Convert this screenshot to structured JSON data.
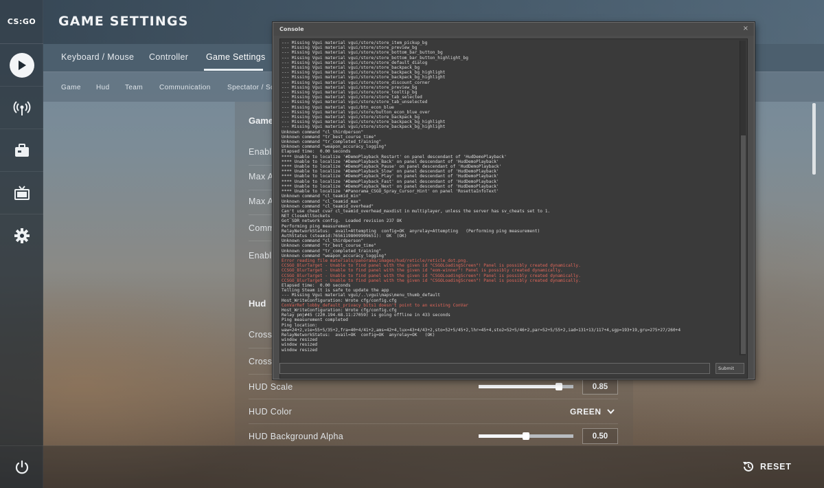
{
  "app": {
    "logo_text": "CS:GO",
    "title": "GAME SETTINGS"
  },
  "sidebar": {
    "items": [
      {
        "icon": "play-icon"
      },
      {
        "icon": "broadcast-icon"
      },
      {
        "icon": "inventory-icon"
      },
      {
        "icon": "tv-icon"
      },
      {
        "icon": "gear-icon"
      },
      {
        "icon": "power-icon"
      }
    ]
  },
  "tabs": [
    {
      "label": "Keyboard / Mouse"
    },
    {
      "label": "Controller"
    },
    {
      "label": "Game Settings",
      "active": true
    }
  ],
  "subtabs": [
    {
      "label": "Game"
    },
    {
      "label": "Hud"
    },
    {
      "label": "Team"
    },
    {
      "label": "Communication"
    },
    {
      "label": "Spectator / Sc"
    }
  ],
  "settings": {
    "game_section_head": "Game",
    "rows_partial": [
      "Enable",
      "Max A",
      "Max A",
      "Comm",
      "Enable"
    ],
    "hud_section_head": "Hud",
    "crosshair_rows": [
      "Crossh",
      "Crossh"
    ],
    "hud_scale_label": "HUD Scale",
    "hud_scale_value": "0.85",
    "hud_scale": 0.85,
    "hud_color_label": "HUD Color",
    "hud_color_value": "GREEN",
    "hud_bg_alpha_label": "HUD Background Alpha",
    "hud_bg_alpha_value": "0.50",
    "hud_bg_alpha": 0.5
  },
  "bottom": {
    "reset_label": "RESET"
  },
  "console": {
    "title": "Console",
    "close_glyph": "×",
    "submit_label": "Submit",
    "input_value": "",
    "lines": [
      {
        "t": "--- Missing Vgui material vgui/store/store_item_pickup_bg"
      },
      {
        "t": "--- Missing Vgui material vgui/store/store_preview_bg"
      },
      {
        "t": "--- Missing Vgui material vgui/store/store_bottom_bar_button_bg"
      },
      {
        "t": "--- Missing Vgui material vgui/store/store_bottom_bar_button_highlight_bg"
      },
      {
        "t": "--- Missing Vgui material vgui/store/store_default_dialog"
      },
      {
        "t": "--- Missing Vgui material vgui/store/store_backpack_bg"
      },
      {
        "t": "--- Missing Vgui material vgui/store/store_backpack_bg_highlight"
      },
      {
        "t": "--- Missing Vgui material vgui/store/store_backpack_bg_highlight"
      },
      {
        "t": "--- Missing Vgui material vgui/store/store_discount_corner"
      },
      {
        "t": "--- Missing Vgui material vgui/store/store_preview_bg"
      },
      {
        "t": "--- Missing Vgui material vgui/store/store_tooltip_bg"
      },
      {
        "t": "--- Missing Vgui material vgui/store/store_tab_selected"
      },
      {
        "t": "--- Missing Vgui material vgui/store/store_tab_unselected"
      },
      {
        "t": "--- Missing Vgui material vgui/btn_econ_blue"
      },
      {
        "t": "--- Missing Vgui material vgui/store/button_econ_blue_over"
      },
      {
        "t": "--- Missing Vgui material vgui/store/store_backpack_bg"
      },
      {
        "t": "--- Missing Vgui material vgui/store/store_backpack_bg_highlight"
      },
      {
        "t": "--- Missing Vgui material vgui/store/store_backpack_bg_highlight"
      },
      {
        "t": "Unknown command \"cl_thirdperson\""
      },
      {
        "t": "Unknown command \"tr_best_course_time\""
      },
      {
        "t": "Unknown command \"tr_completed_training\""
      },
      {
        "t": "Unknown command \"weapon_accuracy_logging\""
      },
      {
        "t": "Elapsed time:  0.00 seconds"
      },
      {
        "t": "**** Unable to localize '#DemoPlayback_Restart' on panel descendant of 'HudDemoPlayback'"
      },
      {
        "t": "**** Unable to localize '#DemoPlayback_Back' on panel descendant of 'HudDemoPlayback'"
      },
      {
        "t": "**** Unable to localize '#DemoPlayback_Pause' on panel descendant of 'HudDemoPlayback'"
      },
      {
        "t": "**** Unable to localize '#DemoPlayback_Slow' on panel descendant of 'HudDemoPlayback'"
      },
      {
        "t": "**** Unable to localize '#DemoPlayback_Play' on panel descendant of 'HudDemoPlayback'"
      },
      {
        "t": "**** Unable to localize '#DemoPlayback_Fast' on panel descendant of 'HudDemoPlayback'"
      },
      {
        "t": "**** Unable to localize '#DemoPlayback_Next' on panel descendant of 'HudDemoPlayback'"
      },
      {
        "t": "**** Unable to localize '#Panorama_CSGO_Spray_Cursor_Hint' on panel 'RosettaInfoText'"
      },
      {
        "t": "Unknown command \"cl_teamid_min\""
      },
      {
        "t": "Unknown command \"cl_teamid_max\""
      },
      {
        "t": "Unknown command \"cl_teamid_overhead\""
      },
      {
        "t": "Can't use cheat cvar cl_teamid_overhead_maxdist in multiplayer, unless the server has sv_cheats set to 1."
      },
      {
        "t": "NET_CloseAllSockets"
      },
      {
        "t": "Got SDR network config.  Loaded revision 237 OK"
      },
      {
        "t": "Performing ping measurement"
      },
      {
        "t": "RelayNetworkStatus:  avail=Attempting  config=OK  anyrelay=Attempting   (Performing ping measurement)"
      },
      {
        "t": "AuthStatus (steamid:76561198009909651):  OK  (OK)"
      },
      {
        "t": "Unknown command \"cl_thirdperson\""
      },
      {
        "t": "Unknown command \"tr_best_course_time\""
      },
      {
        "t": "Unknown command \"tr_completed_training\""
      },
      {
        "t": "Unknown command \"weapon_accuracy_logging\""
      },
      {
        "t": "Error reading file materials/panorama/images/hud/reticle/reticle_dot.png.",
        "err": true
      },
      {
        "t": "CCSGO_BlurTarget - Unable to find panel with the given id \"CSGOLoadingScreen\"! Panel is possibly created dynamically.",
        "err": true
      },
      {
        "t": "CCSGO_BlurTarget - Unable to find panel with the given id \"eom-winner\"! Panel is possibly created dynamically.",
        "err": true
      },
      {
        "t": "CCSGO_BlurTarget - Unable to find panel with the given id \"CSGOLoadingScreen\"! Panel is possibly created dynamically.",
        "err": true
      },
      {
        "t": "CCSGO_BlurTarget - Unable to find panel with the given id \"CSGOLoadingScreen\"! Panel is possibly created dynamically.",
        "err": true
      },
      {
        "t": "Elapsed time:  0.00 seconds"
      },
      {
        "t": "Telling Steam it is safe to update the app"
      },
      {
        "t": "--- Missing Vgui material vgui/..\\vgui\\maps\\menu_thumb_default"
      },
      {
        "t": "Host_WriteConfiguration: Wrote cfg/config.cfg"
      },
      {
        "t": "ConVarRef lobby_default_privacy_bits1 doesn't point to an existing ConVar",
        "err": true
      },
      {
        "t": "Host_WriteConfiguration: Wrote cfg/config.cfg"
      },
      {
        "t": "Relay pmj#45 (220.194.68.11:27059) is going offline in 433 seconds"
      },
      {
        "t": "Ping measurement completed"
      },
      {
        "t": "Ping location:"
      },
      {
        "t": "waw=24+2,vie=55+5/35+2,fra=40+4/41+2,ams=42+4,lux=43+4/43+2,sto=52+5/45+2,lhr=45+4,sto2=52+5/46+2,par=52+5/55+2,iad=131+13/117+4,sgp=193+19,gru=275+27/260+4"
      },
      {
        "t": "RelayNetworkStatus:  avail=OK  config=OK  anyrelay=OK   (OK)"
      },
      {
        "t": "window resized"
      },
      {
        "t": "window resized"
      },
      {
        "t": "window resized"
      }
    ]
  },
  "colors": {
    "console_error": "#e2675a",
    "accent": "#e8eef2"
  }
}
